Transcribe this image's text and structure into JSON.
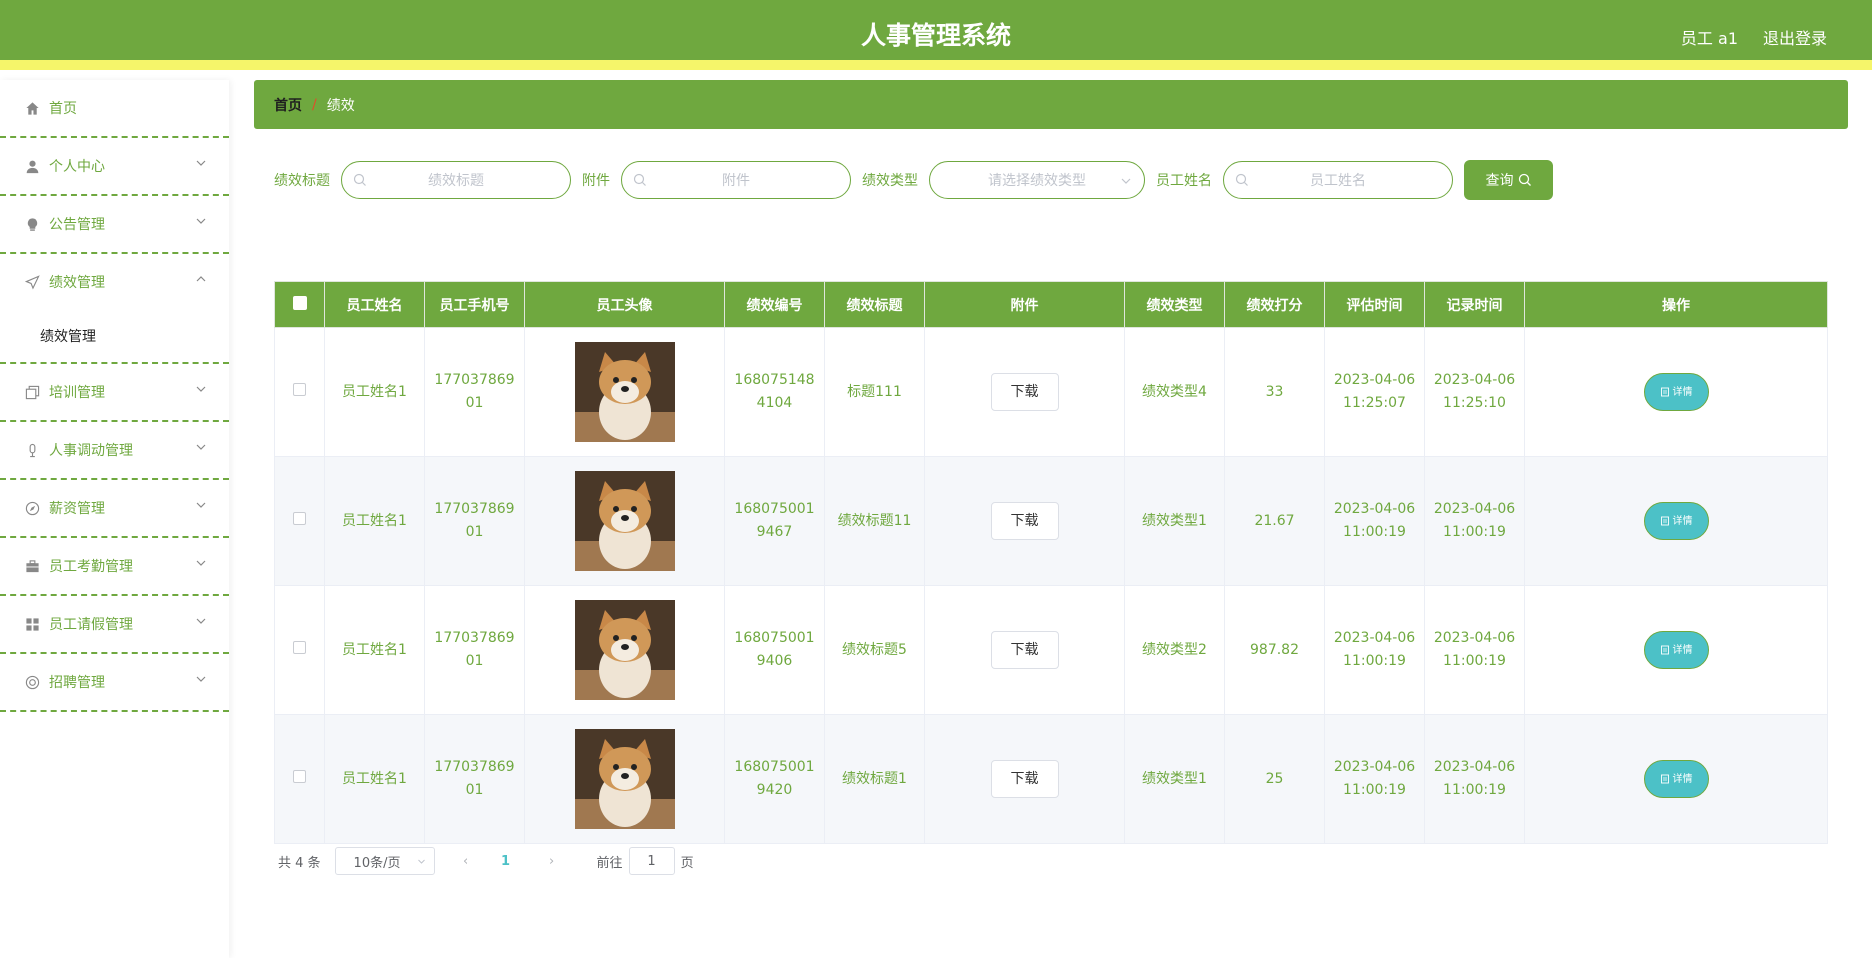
{
  "header": {
    "title": "人事管理系统",
    "user": "员工 a1",
    "logout": "退出登录"
  },
  "sidebar": {
    "items": [
      {
        "label": "首页",
        "icon": "home-icon"
      },
      {
        "label": "个人中心",
        "icon": "user-icon"
      },
      {
        "label": "公告管理",
        "icon": "bulb-icon"
      },
      {
        "label": "绩效管理",
        "icon": "send-icon",
        "expanded": true,
        "sub": "绩效管理"
      },
      {
        "label": "培训管理",
        "icon": "copy-icon"
      },
      {
        "label": "人事调动管理",
        "icon": "mic-icon"
      },
      {
        "label": "薪资管理",
        "icon": "compass-icon"
      },
      {
        "label": "员工考勤管理",
        "icon": "briefcase-icon"
      },
      {
        "label": "员工请假管理",
        "icon": "grid-icon"
      },
      {
        "label": "招聘管理",
        "icon": "help-icon"
      }
    ]
  },
  "breadcrumb": {
    "home": "首页",
    "sep": "/",
    "current": "绩效"
  },
  "search": {
    "title_label": "绩效标题",
    "title_placeholder": "绩效标题",
    "attach_label": "附件",
    "attach_placeholder": "附件",
    "type_label": "绩效类型",
    "type_placeholder": "请选择绩效类型",
    "name_label": "员工姓名",
    "name_placeholder": "员工姓名",
    "query_button": "查询"
  },
  "table": {
    "headers": [
      "员工姓名",
      "员工手机号",
      "员工头像",
      "绩效编号",
      "绩效标题",
      "附件",
      "绩效类型",
      "绩效打分",
      "评估时间",
      "记录时间",
      "操作"
    ],
    "download_label": "下载",
    "detail_label": "详情",
    "rows": [
      {
        "name": "员工姓名1",
        "phone1": "177037869",
        "phone2": "01",
        "no1": "168075148",
        "no2": "4104",
        "title": "标题111",
        "type": "绩效类型4",
        "score": "33",
        "eval_date": "2023-04-06",
        "eval_time": "11:25:07",
        "rec_date": "2023-04-06",
        "rec_time": "11:25:10"
      },
      {
        "name": "员工姓名1",
        "phone1": "177037869",
        "phone2": "01",
        "no1": "168075001",
        "no2": "9467",
        "title": "绩效标题11",
        "type": "绩效类型1",
        "score": "21.67",
        "eval_date": "2023-04-06",
        "eval_time": "11:00:19",
        "rec_date": "2023-04-06",
        "rec_time": "11:00:19"
      },
      {
        "name": "员工姓名1",
        "phone1": "177037869",
        "phone2": "01",
        "no1": "168075001",
        "no2": "9406",
        "title": "绩效标题5",
        "type": "绩效类型2",
        "score": "987.82",
        "eval_date": "2023-04-06",
        "eval_time": "11:00:19",
        "rec_date": "2023-04-06",
        "rec_time": "11:00:19"
      },
      {
        "name": "员工姓名1",
        "phone1": "177037869",
        "phone2": "01",
        "no1": "168075001",
        "no2": "9420",
        "title": "绩效标题1",
        "type": "绩效类型1",
        "score": "25",
        "eval_date": "2023-04-06",
        "eval_time": "11:00:19",
        "rec_date": "2023-04-06",
        "rec_time": "11:00:19"
      }
    ]
  },
  "pagination": {
    "total": "共 4 条",
    "page_size": "10条/页",
    "current_page": "1",
    "goto_label": "前往",
    "goto_value": "1",
    "page_suffix": "页"
  },
  "colors": {
    "primary": "#6fa83f",
    "accent_stripe": "#f5f56a",
    "detail": "#4cc1c7"
  }
}
